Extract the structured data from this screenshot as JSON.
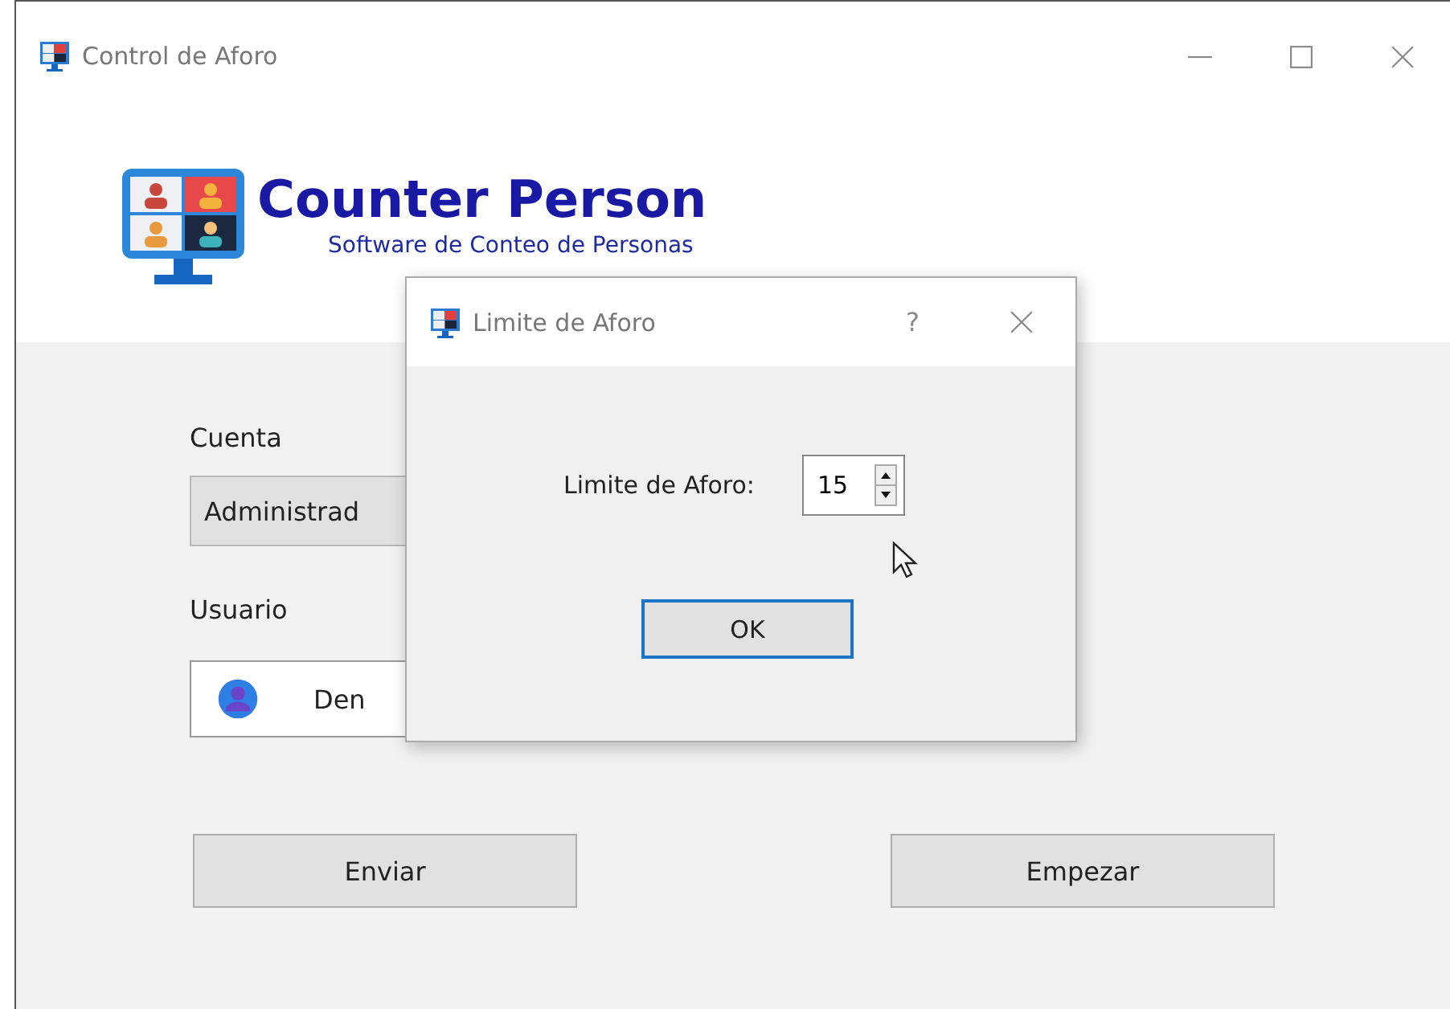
{
  "window": {
    "title": "Control de Aforo"
  },
  "header": {
    "title": "Counter Person",
    "subtitle": "Software de Conteo de Personas"
  },
  "form": {
    "account_label": "Cuenta",
    "account_value": "Administrad",
    "user_label": "Usuario",
    "user_value": "Den"
  },
  "buttons": [
    "Enviar",
    "Empezar"
  ],
  "dialog": {
    "title": "Limite de Aforo",
    "help": "?",
    "label": "Limite de Aforo:",
    "value": "15",
    "ok": "OK"
  }
}
